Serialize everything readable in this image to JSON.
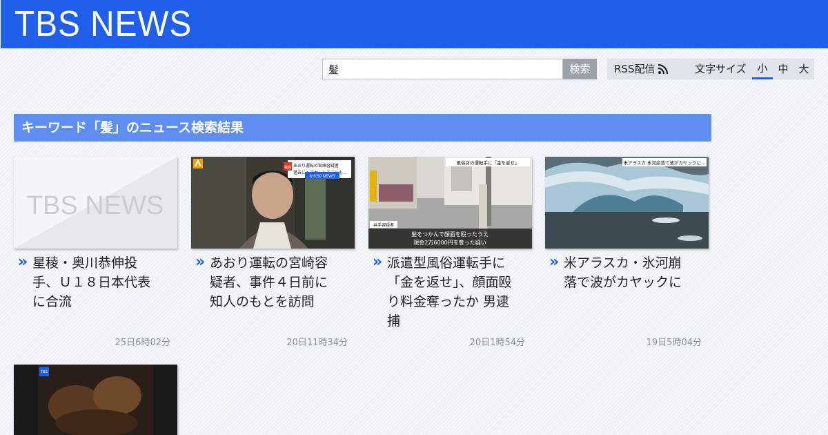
{
  "header": {
    "logo": "TBS NEWS"
  },
  "search": {
    "value": "髪",
    "button": "検索"
  },
  "utility": {
    "rss_label": "RSS配信",
    "font_size_label": "文字サイズ",
    "font_sizes": [
      "小",
      "中",
      "大"
    ],
    "active_font_size": "小"
  },
  "results": {
    "title": "キーワード「髪」のニュース検索結果",
    "articles": [
      {
        "headline": "星稜・奥川恭伸投手、Ｕ１８日本代表に合流",
        "time": "25日6時02分",
        "thumb": "tbs-logo"
      },
      {
        "headline": "あおり運転の宮崎容疑者、事件４日前に知人のもとを訪問",
        "time": "20日11時34分",
        "thumb": "portrait",
        "caption_lines": [
          "あおり運転の宮崎容疑者",
          "過去にヘアカットモデルも…"
        ],
        "badge": "独自",
        "channel": "N 6:50 NEWS"
      },
      {
        "headline": "派遣型風俗運転手に「金を返せ」、顔面殴り料金奪ったか 男逮捕",
        "time": "20日1時54分",
        "thumb": "street",
        "caption_top": "風俗店の運転手に「金を返せ」",
        "suspect_tag": "井手容疑者",
        "caption_lines": [
          "髪をつかんで顔面を殴ったうえ",
          "現金2万6000円を奪った疑い"
        ]
      },
      {
        "headline": "米アラスカ・氷河崩落で波がカヤックに",
        "time": "19日5時04分",
        "thumb": "glacier",
        "caption_top": "米アラスカ 氷河崩落で波がカヤックに…"
      },
      {
        "headline": "",
        "time": "",
        "thumb": "night"
      }
    ]
  },
  "colors": {
    "brand": "#1f5fec",
    "title_bar": "#5d8ef0",
    "chevron": "#1f5fec"
  }
}
